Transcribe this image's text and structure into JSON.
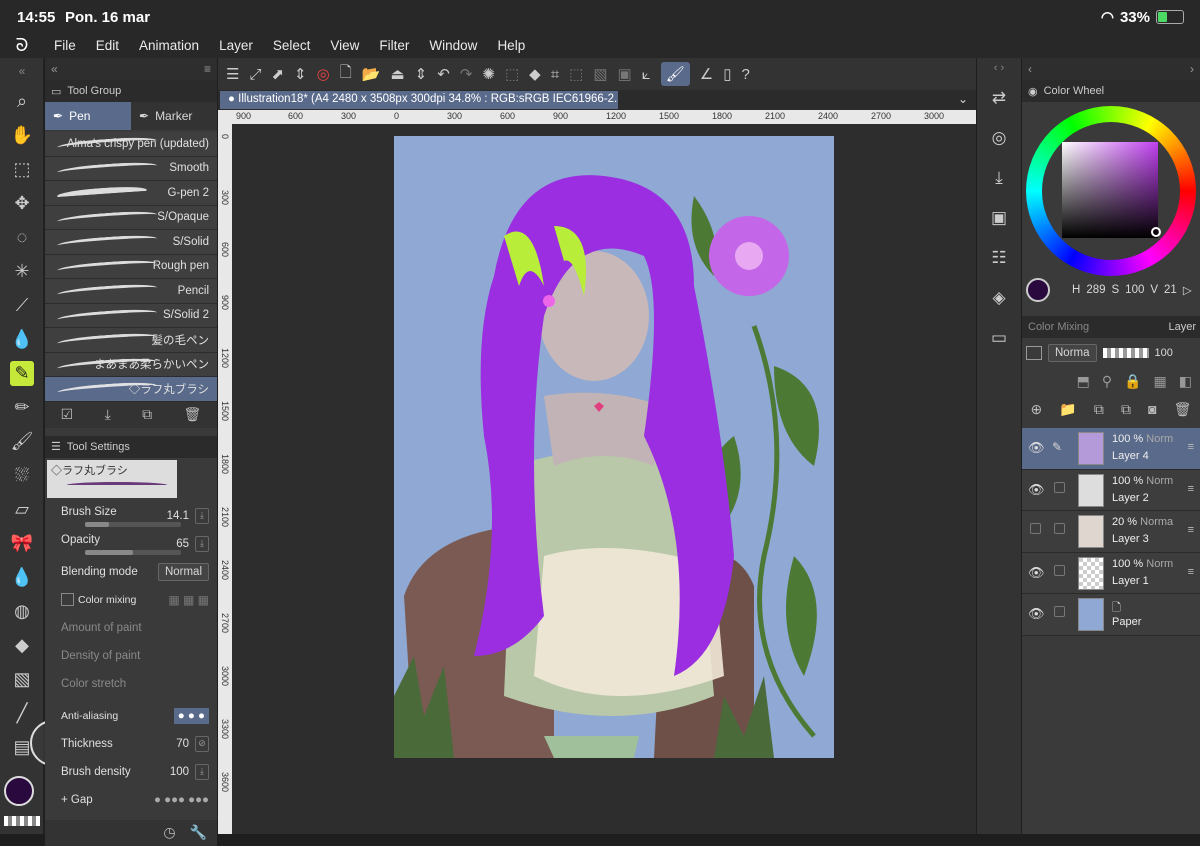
{
  "status": {
    "time": "14:55",
    "date": "Pon. 16 mar",
    "battery": "33%"
  },
  "menu": [
    "File",
    "Edit",
    "Animation",
    "Layer",
    "Select",
    "View",
    "Filter",
    "Window",
    "Help"
  ],
  "tool_group": {
    "title": "Tool Group",
    "tabs": [
      {
        "label": "Pen",
        "active": true
      },
      {
        "label": "Marker",
        "active": false
      }
    ],
    "brushes": [
      "Alma's crispy pen (updated)",
      "Smooth",
      "G-pen 2",
      "S/Opaque",
      "S/Solid",
      "Rough pen",
      "Pencil",
      "S/Solid 2",
      "髪の毛ペン",
      "まあまあ柔らかいペン",
      "◇ラフ丸ブラシ"
    ],
    "selected_brush": "◇ラフ丸ブラシ"
  },
  "tool_settings": {
    "title": "Tool Settings",
    "preview_name": "◇ラフ丸ブラシ",
    "brush_size": {
      "label": "Brush Size",
      "value": "14.1"
    },
    "opacity": {
      "label": "Opacity",
      "value": "65"
    },
    "blending": {
      "label": "Blending mode",
      "value": "Normal"
    },
    "color_mixing": "Color mixing",
    "amount_paint": "Amount of paint",
    "density_paint": "Density of paint",
    "color_stretch": "Color stretch",
    "anti_aliasing": "Anti-aliasing",
    "thickness": {
      "label": "Thickness",
      "value": "70"
    },
    "brush_density": {
      "label": "Brush density",
      "value": "100"
    },
    "gap": "Gap"
  },
  "document": {
    "tab": "Illustration18* (A4 2480 x 3508px 300dpi 34.8% : RGB:sRGB IEC61966-2.1)"
  },
  "ruler_top": [
    "900",
    "600",
    "300",
    "0",
    "300",
    "600",
    "900",
    "1200",
    "1500",
    "1800",
    "2100",
    "2400",
    "2700",
    "3000"
  ],
  "ruler_left": [
    "0",
    "300",
    "600",
    "900",
    "1200",
    "1500",
    "1800",
    "2100",
    "2400",
    "2700",
    "3000",
    "3300",
    "3600"
  ],
  "color_wheel": {
    "title": "Color Wheel",
    "h": "289",
    "s": "100",
    "v": "21",
    "current_color": "#2a0a3e",
    "hue_color": "#c040f0"
  },
  "layer_panel": {
    "tabs": [
      "Color Mixing",
      "Layer"
    ],
    "blend": "Norma",
    "opacity": "100",
    "layers": [
      {
        "pct": "100 %",
        "mode": "Norm",
        "name": "Layer 4",
        "selected": true,
        "visible": true
      },
      {
        "pct": "100 %",
        "mode": "Norm",
        "name": "Layer 2",
        "selected": false,
        "visible": true
      },
      {
        "pct": "20 %",
        "mode": "Norma",
        "name": "Layer 3",
        "selected": false,
        "visible": false
      },
      {
        "pct": "100 %",
        "mode": "Norm",
        "name": "Layer 1",
        "selected": false,
        "visible": true
      },
      {
        "pct": "",
        "mode": "",
        "name": "Paper",
        "selected": false,
        "visible": true
      }
    ]
  },
  "canvas": {
    "background": "#8fa8d4"
  }
}
